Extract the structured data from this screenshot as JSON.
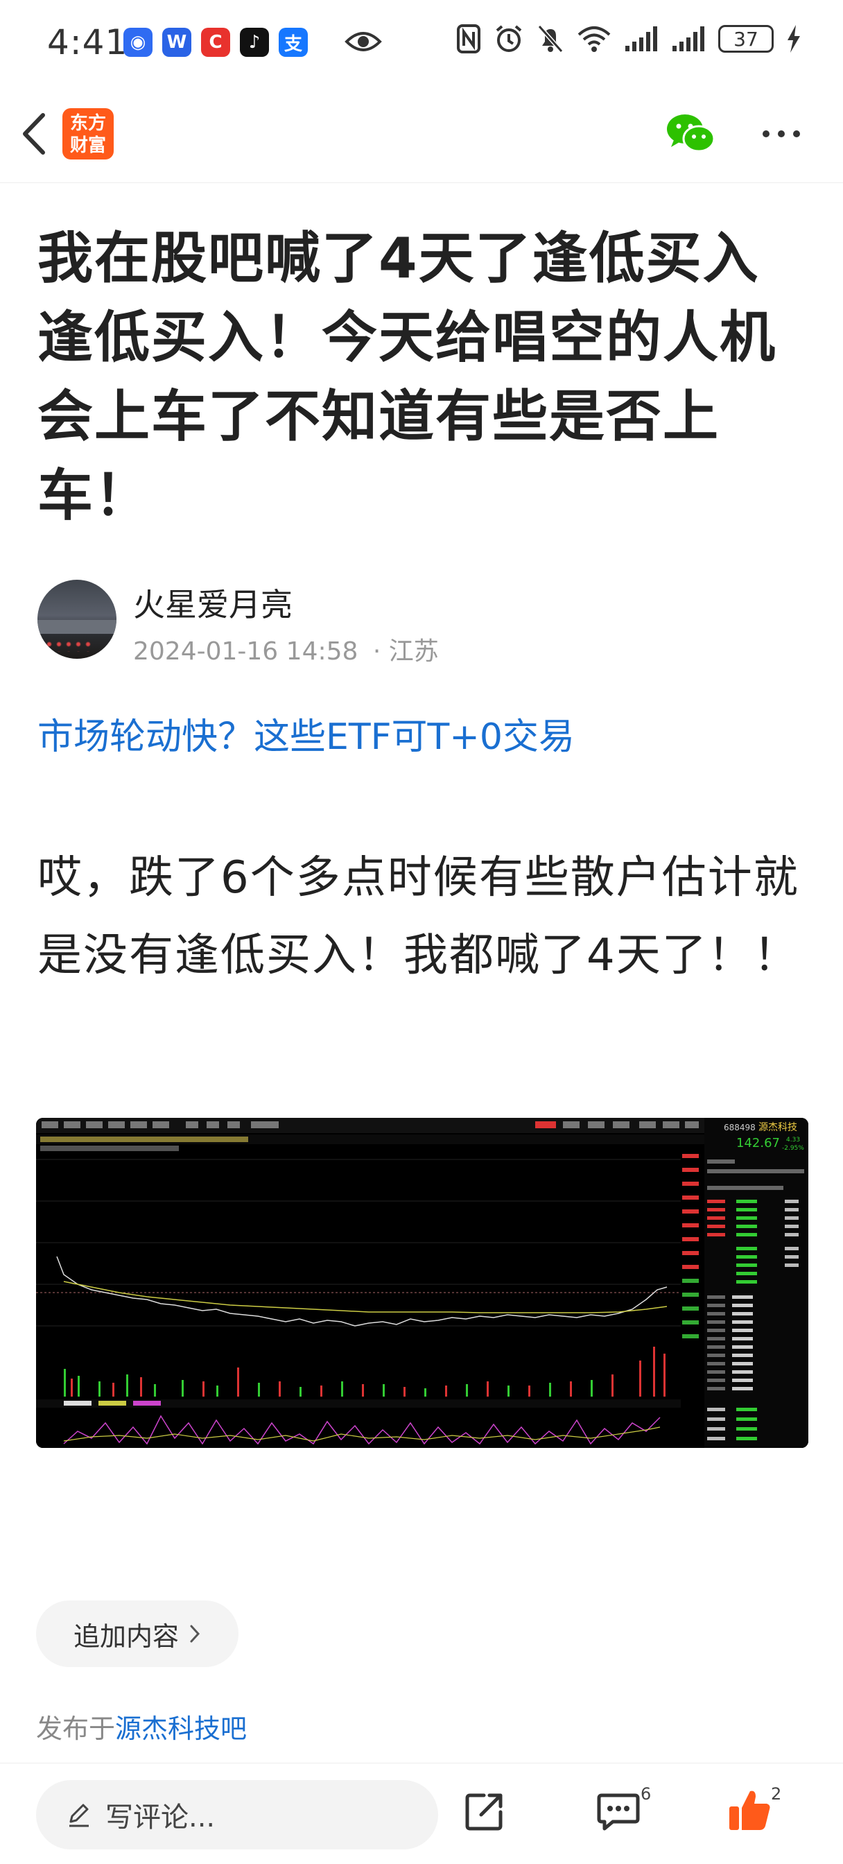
{
  "status_bar": {
    "time": "4:41",
    "battery": "37",
    "app_icons": [
      {
        "name": "baidu-icon",
        "glyph": "🐾",
        "color": "#2f6bf2"
      },
      {
        "name": "wps-icon",
        "glyph": "W",
        "color": "#2a63e6"
      },
      {
        "name": "csdn-icon",
        "glyph": "C",
        "color": "#e8322d"
      },
      {
        "name": "tiktok-icon",
        "glyph": "♪",
        "color": "#111111"
      },
      {
        "name": "alipay-icon",
        "glyph": "支",
        "color": "#1677ff"
      }
    ]
  },
  "header": {
    "logo_line1": "东方",
    "logo_line2": "财富"
  },
  "post": {
    "title": "我在股吧喊了4天了逢低买入逢低买入！今天给唱空的人机会上车了不知道有些是否上车！",
    "author": "火星爱月亮",
    "datetime": "2024-01-16 14:58",
    "location": "· 江苏",
    "ad_link": "市场轮动快？这些ETF可T+0交易",
    "body": "哎，跌了6个多点时候有些散户估计就是没有逢低买入！我都喊了4天了！！"
  },
  "stock_panel": {
    "code": "688498",
    "name": "源杰科技",
    "price": "142.67",
    "change": "4.33",
    "change_pct": "-2.95%"
  },
  "actions": {
    "add_content": "追加内容",
    "published_prefix": "发布于",
    "published_bar": "源杰科技吧",
    "comment_placeholder": "写评论...",
    "comment_count": "6",
    "like_count": "2"
  },
  "colors": {
    "accent": "#1a6fd1",
    "brand": "#ff5a1a",
    "like": "#ff5a1a",
    "wechat": "#2dc100"
  }
}
